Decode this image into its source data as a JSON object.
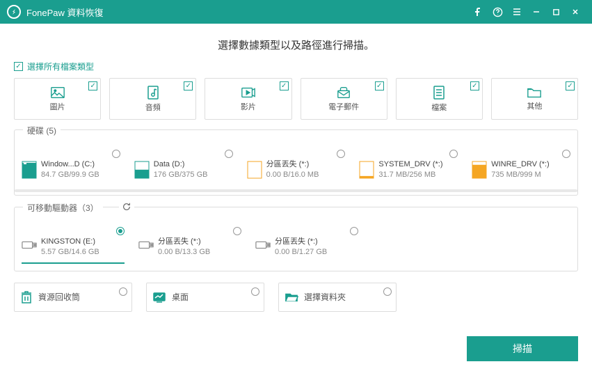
{
  "app": {
    "title": "FonePaw 資料恢復"
  },
  "heading": "選擇數據類型以及路徑進行掃描。",
  "select_all": "選擇所有檔案類型",
  "types": [
    {
      "label": "圖片"
    },
    {
      "label": "音頻"
    },
    {
      "label": "影片"
    },
    {
      "label": "電子郵件"
    },
    {
      "label": "檔案"
    },
    {
      "label": "其他"
    }
  ],
  "disks": {
    "legend": "硬碟 (5)",
    "items": [
      {
        "name": "Window...D (C:)",
        "size": "84.7 GB/99.9 GB",
        "fill": 0.85,
        "color": "#1a9e8f"
      },
      {
        "name": "Data (D:)",
        "size": "176 GB/375 GB",
        "fill": 0.47,
        "color": "#1a9e8f"
      },
      {
        "name": "分區丟失 (*:)",
        "size": "0.00  B/16.0 MB",
        "fill": 0.0,
        "color": "#f5a623"
      },
      {
        "name": "SYSTEM_DRV (*:)",
        "size": "31.7 MB/256 MB",
        "fill": 0.12,
        "color": "#f5a623"
      },
      {
        "name": "WINRE_DRV (*:)",
        "size": "735 MB/999 M",
        "fill": 0.74,
        "color": "#f5a623"
      }
    ]
  },
  "removable": {
    "legend": "可移動驅動器（3）",
    "items": [
      {
        "name": "KINGSTON (E:)",
        "size": "5.57 GB/14.6 GB",
        "selected": true
      },
      {
        "name": "分區丟失 (*:)",
        "size": "0.00  B/13.3 GB",
        "selected": false
      },
      {
        "name": "分區丟失 (*:)",
        "size": "0.00  B/1.27 GB",
        "selected": false
      }
    ]
  },
  "locations": [
    {
      "label": "資源回收筒"
    },
    {
      "label": "桌面"
    },
    {
      "label": "選擇資料夾"
    }
  ],
  "scan_button": "掃描"
}
